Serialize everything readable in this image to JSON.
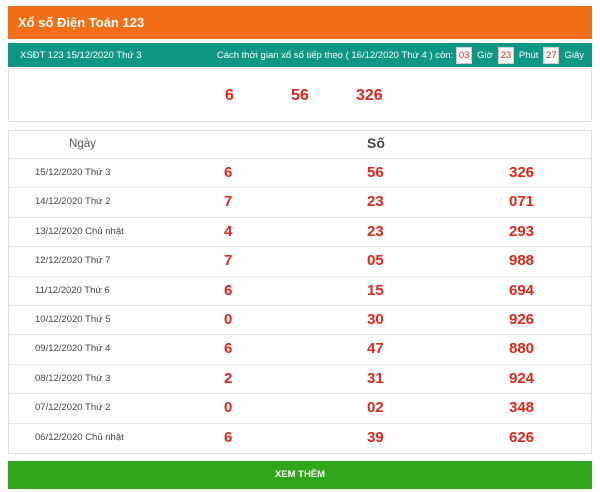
{
  "header": {
    "title": "Xổ số Điện Toán 123"
  },
  "info": {
    "draw_label": "XSĐT 123 15/12/2020 Thứ 3",
    "countdown_text": "Cách thời gian xổ số tiếp theo (  16/12/2020 Thứ 4 ) còn:",
    "hours": "03",
    "hours_unit": "Giờ",
    "minutes": "23",
    "minutes_unit": "Phút",
    "seconds": "27",
    "seconds_unit": "Giây"
  },
  "latest": {
    "n1": "6",
    "n2": "56",
    "n3": "326"
  },
  "table": {
    "col_date": "Ngày",
    "col_numbers": "Số",
    "rows": [
      {
        "date": "15/12/2020 Thứ 3",
        "v1": "6",
        "v2": "56",
        "v3": "326"
      },
      {
        "date": "14/12/2020 Thứ 2",
        "v1": "7",
        "v2": "23",
        "v3": "071"
      },
      {
        "date": "13/12/2020 Chủ nhật",
        "v1": "4",
        "v2": "23",
        "v3": "293"
      },
      {
        "date": "12/12/2020 Thứ 7",
        "v1": "7",
        "v2": "05",
        "v3": "988"
      },
      {
        "date": "11/12/2020 Thứ 6",
        "v1": "6",
        "v2": "15",
        "v3": "694"
      },
      {
        "date": "10/12/2020 Thứ 5",
        "v1": "0",
        "v2": "30",
        "v3": "926"
      },
      {
        "date": "09/12/2020 Thứ 4",
        "v1": "6",
        "v2": "47",
        "v3": "880"
      },
      {
        "date": "08/12/2020 Thứ 3",
        "v1": "2",
        "v2": "31",
        "v3": "924"
      },
      {
        "date": "07/12/2020 Thứ 2",
        "v1": "0",
        "v2": "02",
        "v3": "348"
      },
      {
        "date": "06/12/2020 Chủ nhật",
        "v1": "6",
        "v2": "39",
        "v3": "626"
      }
    ]
  },
  "more_button": {
    "label": "XEM THÊM"
  },
  "colors": {
    "header": "#f26f17",
    "info_bar": "#0e9785",
    "numbers": "#e0251b",
    "button": "#2fa619"
  }
}
